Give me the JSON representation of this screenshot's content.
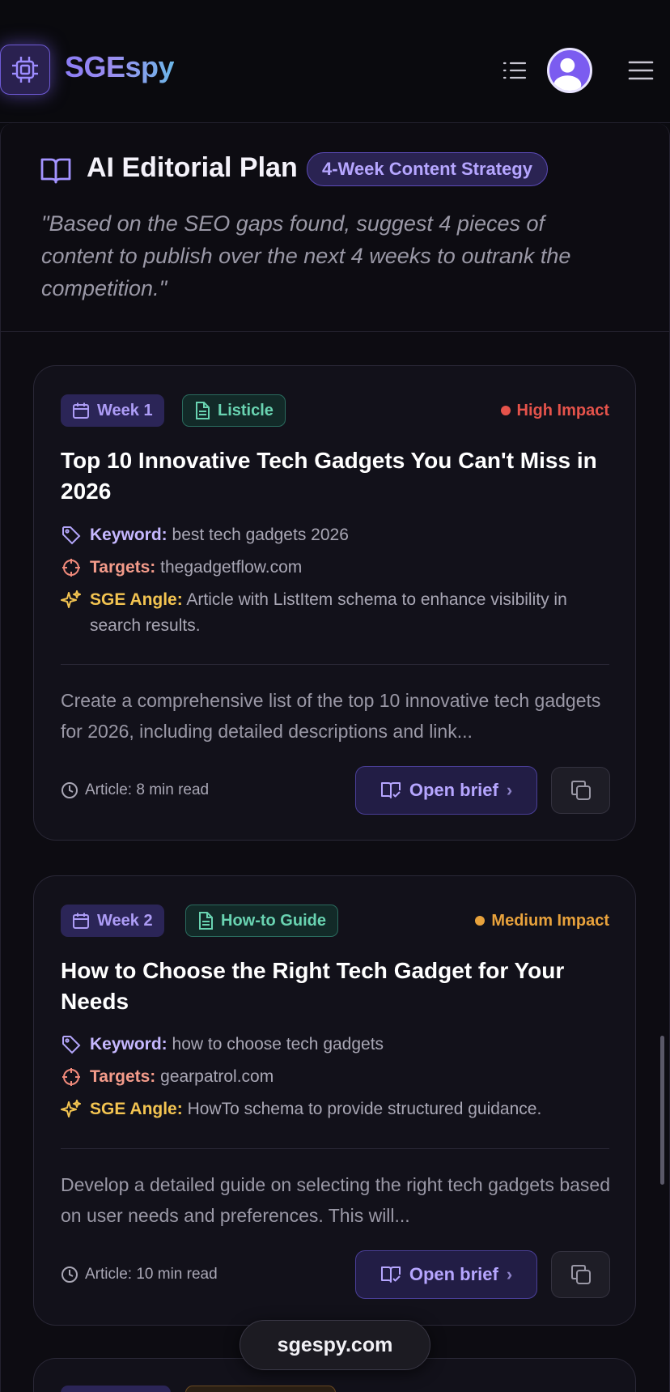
{
  "app": {
    "name": "SGEspy"
  },
  "colors": {
    "accent": "#8b7cf6",
    "high_impact": "#e5534b",
    "medium_impact": "#e8a23c",
    "type_green": "#69d3b1"
  },
  "icons": {
    "logo": "chip-icon",
    "list": "list-icon",
    "avatar": "user-avatar",
    "menu": "hamburger-icon",
    "plan": "book-open-icon"
  },
  "panel": {
    "title": "AI Editorial Plan",
    "badge": "4-Week Content Strategy",
    "quote": "\"Based on the SEO gaps found, suggest 4 pieces of content to publish over the next 4 weeks to outrank the competition.\""
  },
  "cards": [
    {
      "week": "Week 1",
      "type": "Listicle",
      "impact": "High Impact",
      "title": "Top 10 Innovative Tech Gadgets You Can't Miss in 2026",
      "keyword_label": "Keyword:",
      "keyword": "best tech gadgets 2026",
      "targets_label": "Targets:",
      "targets": "thegadgetflow.com",
      "sge_label": "SGE Angle:",
      "sge": "Article with ListItem schema to enhance visibility in search results.",
      "description": "Create a comprehensive list of the top 10 innovative tech gadgets for 2026, including detailed descriptions and link...",
      "read_time": "Article: 8 min read",
      "open_label": "Open brief"
    },
    {
      "week": "Week 2",
      "type": "How-to Guide",
      "impact": "Medium Impact",
      "title": "How to Choose the Right Tech Gadget for Your Needs",
      "keyword_label": "Keyword:",
      "keyword": "how to choose tech gadgets",
      "targets_label": "Targets:",
      "targets": "gearpatrol.com",
      "sge_label": "SGE Angle:",
      "sge": "HowTo schema to provide structured guidance.",
      "description": "Develop a detailed guide on selecting the right tech gadgets based on user needs and preferences. This will...",
      "read_time": "Article: 10 min read",
      "open_label": "Open brief"
    }
  ],
  "footer": {
    "domain": "sgespy.com"
  }
}
